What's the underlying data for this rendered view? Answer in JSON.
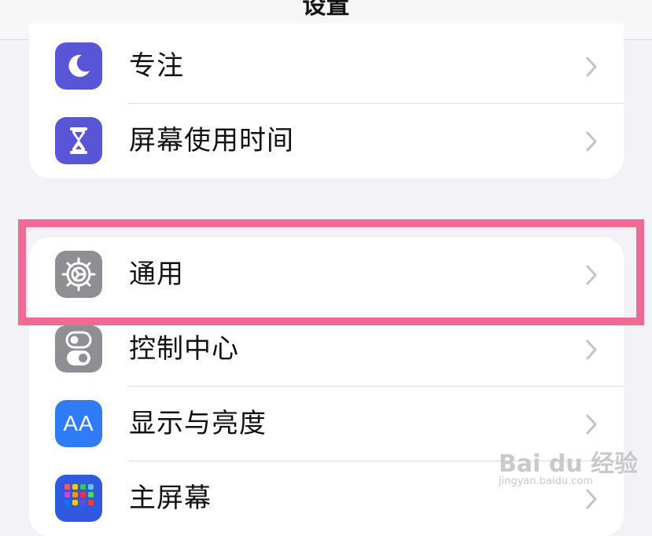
{
  "header": {
    "title": "设置"
  },
  "group1": {
    "items": [
      {
        "label": "专注",
        "icon": "moon-icon",
        "color": "#5856d6"
      },
      {
        "label": "屏幕使用时间",
        "icon": "hourglass-icon",
        "color": "#5856d6"
      }
    ]
  },
  "group2": {
    "items": [
      {
        "label": "通用",
        "icon": "gear-icon",
        "color": "#8e8e93"
      },
      {
        "label": "控制中心",
        "icon": "toggles-icon",
        "color": "#8e8e93"
      },
      {
        "label": "显示与亮度",
        "icon": "text-size-icon",
        "color": "#2f7cf6",
        "icon_text": "AA"
      },
      {
        "label": "主屏幕",
        "icon": "home-grid-icon",
        "color": "#2f5ae0"
      }
    ]
  },
  "highlight": {
    "color": "#f06a93"
  },
  "watermark": {
    "brand": "Bai du 经验",
    "url": "jingyan.baidu.com"
  }
}
